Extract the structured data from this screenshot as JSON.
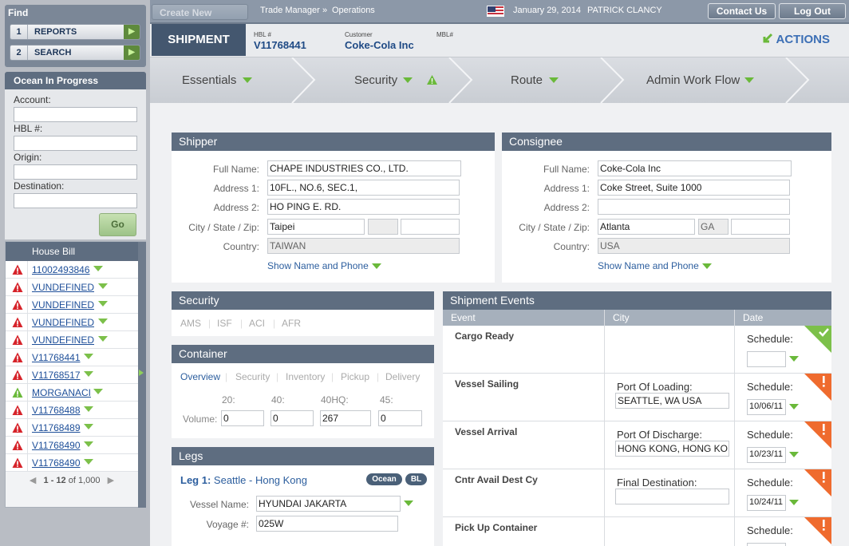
{
  "sidebar": {
    "find_title": "Find",
    "find_buttons": [
      {
        "num": "1",
        "label": "REPORTS"
      },
      {
        "num": "2",
        "label": "SEARCH"
      }
    ],
    "ocean_title": "Ocean In Progress",
    "fields": [
      "Account:",
      "HBL #:",
      "Origin:",
      "Destination:"
    ],
    "go_label": "Go",
    "house_bill_header": "House Bill",
    "rows": [
      {
        "status": "error",
        "label": "11002493846"
      },
      {
        "status": "error",
        "label": "VUNDEFINED"
      },
      {
        "status": "error",
        "label": "VUNDEFINED"
      },
      {
        "status": "error",
        "label": "VUNDEFINED"
      },
      {
        "status": "error",
        "label": "VUNDEFINED"
      },
      {
        "status": "error",
        "label": "V11768441"
      },
      {
        "status": "error",
        "label": "V11768517"
      },
      {
        "status": "ok",
        "label": "MORGANACI"
      },
      {
        "status": "error",
        "label": "V11768488"
      },
      {
        "status": "error",
        "label": "V11768489"
      },
      {
        "status": "error",
        "label": "V11768490"
      },
      {
        "status": "error",
        "label": "V11768490"
      }
    ],
    "pager_range": "1 - 12",
    "pager_of": "of 1,000"
  },
  "topbar": {
    "create_new": "Create New",
    "crumb1": "Trade Manager",
    "crumb_sep": "»",
    "crumb2": "Operations",
    "date": "January 29, 2014",
    "user": "PATRICK CLANCY",
    "contact": "Contact Us",
    "logout": "Log Out"
  },
  "shipment": {
    "tag": "SHIPMENT",
    "hbl_label": "HBL #",
    "hbl": "V11768441",
    "customer_label": "Customer",
    "customer": "Coke-Cola Inc",
    "mbl_label": "MBL#",
    "actions": "ACTIONS"
  },
  "tabs": [
    "Essentials",
    "Security",
    "Route",
    "Admin Work Flow"
  ],
  "shipper": {
    "title": "Shipper",
    "labels": {
      "full_name": "Full Name:",
      "address1": "Address 1:",
      "address2": "Address 2:",
      "csz": "City / State / Zip:",
      "country": "Country:"
    },
    "full_name": "CHAPE INDUSTRIES CO., LTD.",
    "address1": "10FL., NO.6, SEC.1,",
    "address2": "HO PING E. RD.",
    "city": "Taipei",
    "state": "",
    "zip": "",
    "country": "TAIWAN",
    "show_link": "Show Name and Phone"
  },
  "consignee": {
    "title": "Consignee",
    "labels": {
      "full_name": "Full Name:",
      "address1": "Address 1:",
      "address2": "Address 2:",
      "csz": "City / State / Zip:",
      "country": "Country:"
    },
    "full_name": "Coke-Cola Inc",
    "address1": "Coke Street, Suite 1000",
    "address2": "",
    "city": "Atlanta",
    "state": "GA",
    "zip": "",
    "country": "USA",
    "show_link": "Show Name and Phone"
  },
  "security": {
    "title": "Security",
    "tabs": [
      "AMS",
      "ISF",
      "ACI",
      "AFR"
    ]
  },
  "container": {
    "title": "Container",
    "tabs": [
      "Overview",
      "Security",
      "Inventory",
      "Pickup",
      "Delivery"
    ],
    "sizes": [
      "20:",
      "40:",
      "40HQ:",
      "45:"
    ],
    "volume_label": "Volume:",
    "volumes": [
      "0",
      "0",
      "267",
      "0"
    ]
  },
  "legs": {
    "title": "Legs",
    "leg_label": "Leg 1:",
    "route": "Seattle - Hong Kong",
    "pills": [
      "Ocean",
      "BL"
    ],
    "vessel_label": "Vessel Name:",
    "vessel": "HYUNDAI JAKARTA",
    "voyage_label": "Voyage #:",
    "voyage": "025W"
  },
  "events": {
    "title": "Shipment Events",
    "columns": [
      "Event",
      "City",
      "Date"
    ],
    "schedule_label": "Schedule:",
    "rows": [
      {
        "name": "Cargo Ready",
        "city_label": "",
        "city": "",
        "date": "",
        "flag": "check"
      },
      {
        "name": "Vessel Sailing",
        "city_label": "Port Of Loading:",
        "city": "SEATTLE, WA USA",
        "date": "10/06/11",
        "flag": "alert"
      },
      {
        "name": "Vessel Arrival",
        "city_label": "Port Of Discharge:",
        "city": "HONG KONG, HONG KONG",
        "date": "10/23/11",
        "flag": "alert"
      },
      {
        "name": "Cntr Avail Dest Cy",
        "city_label": "Final Destination:",
        "city": "",
        "date": "10/24/11",
        "flag": "alert"
      },
      {
        "name": "Pick Up Container",
        "city_label": "",
        "city": "",
        "date": "",
        "flag": "alert"
      }
    ]
  },
  "colors": {
    "header_blue": "#5e6d80",
    "accent_green": "#6ab93a",
    "alert_orange": "#ef6b2e",
    "error_red": "#d6232a"
  }
}
